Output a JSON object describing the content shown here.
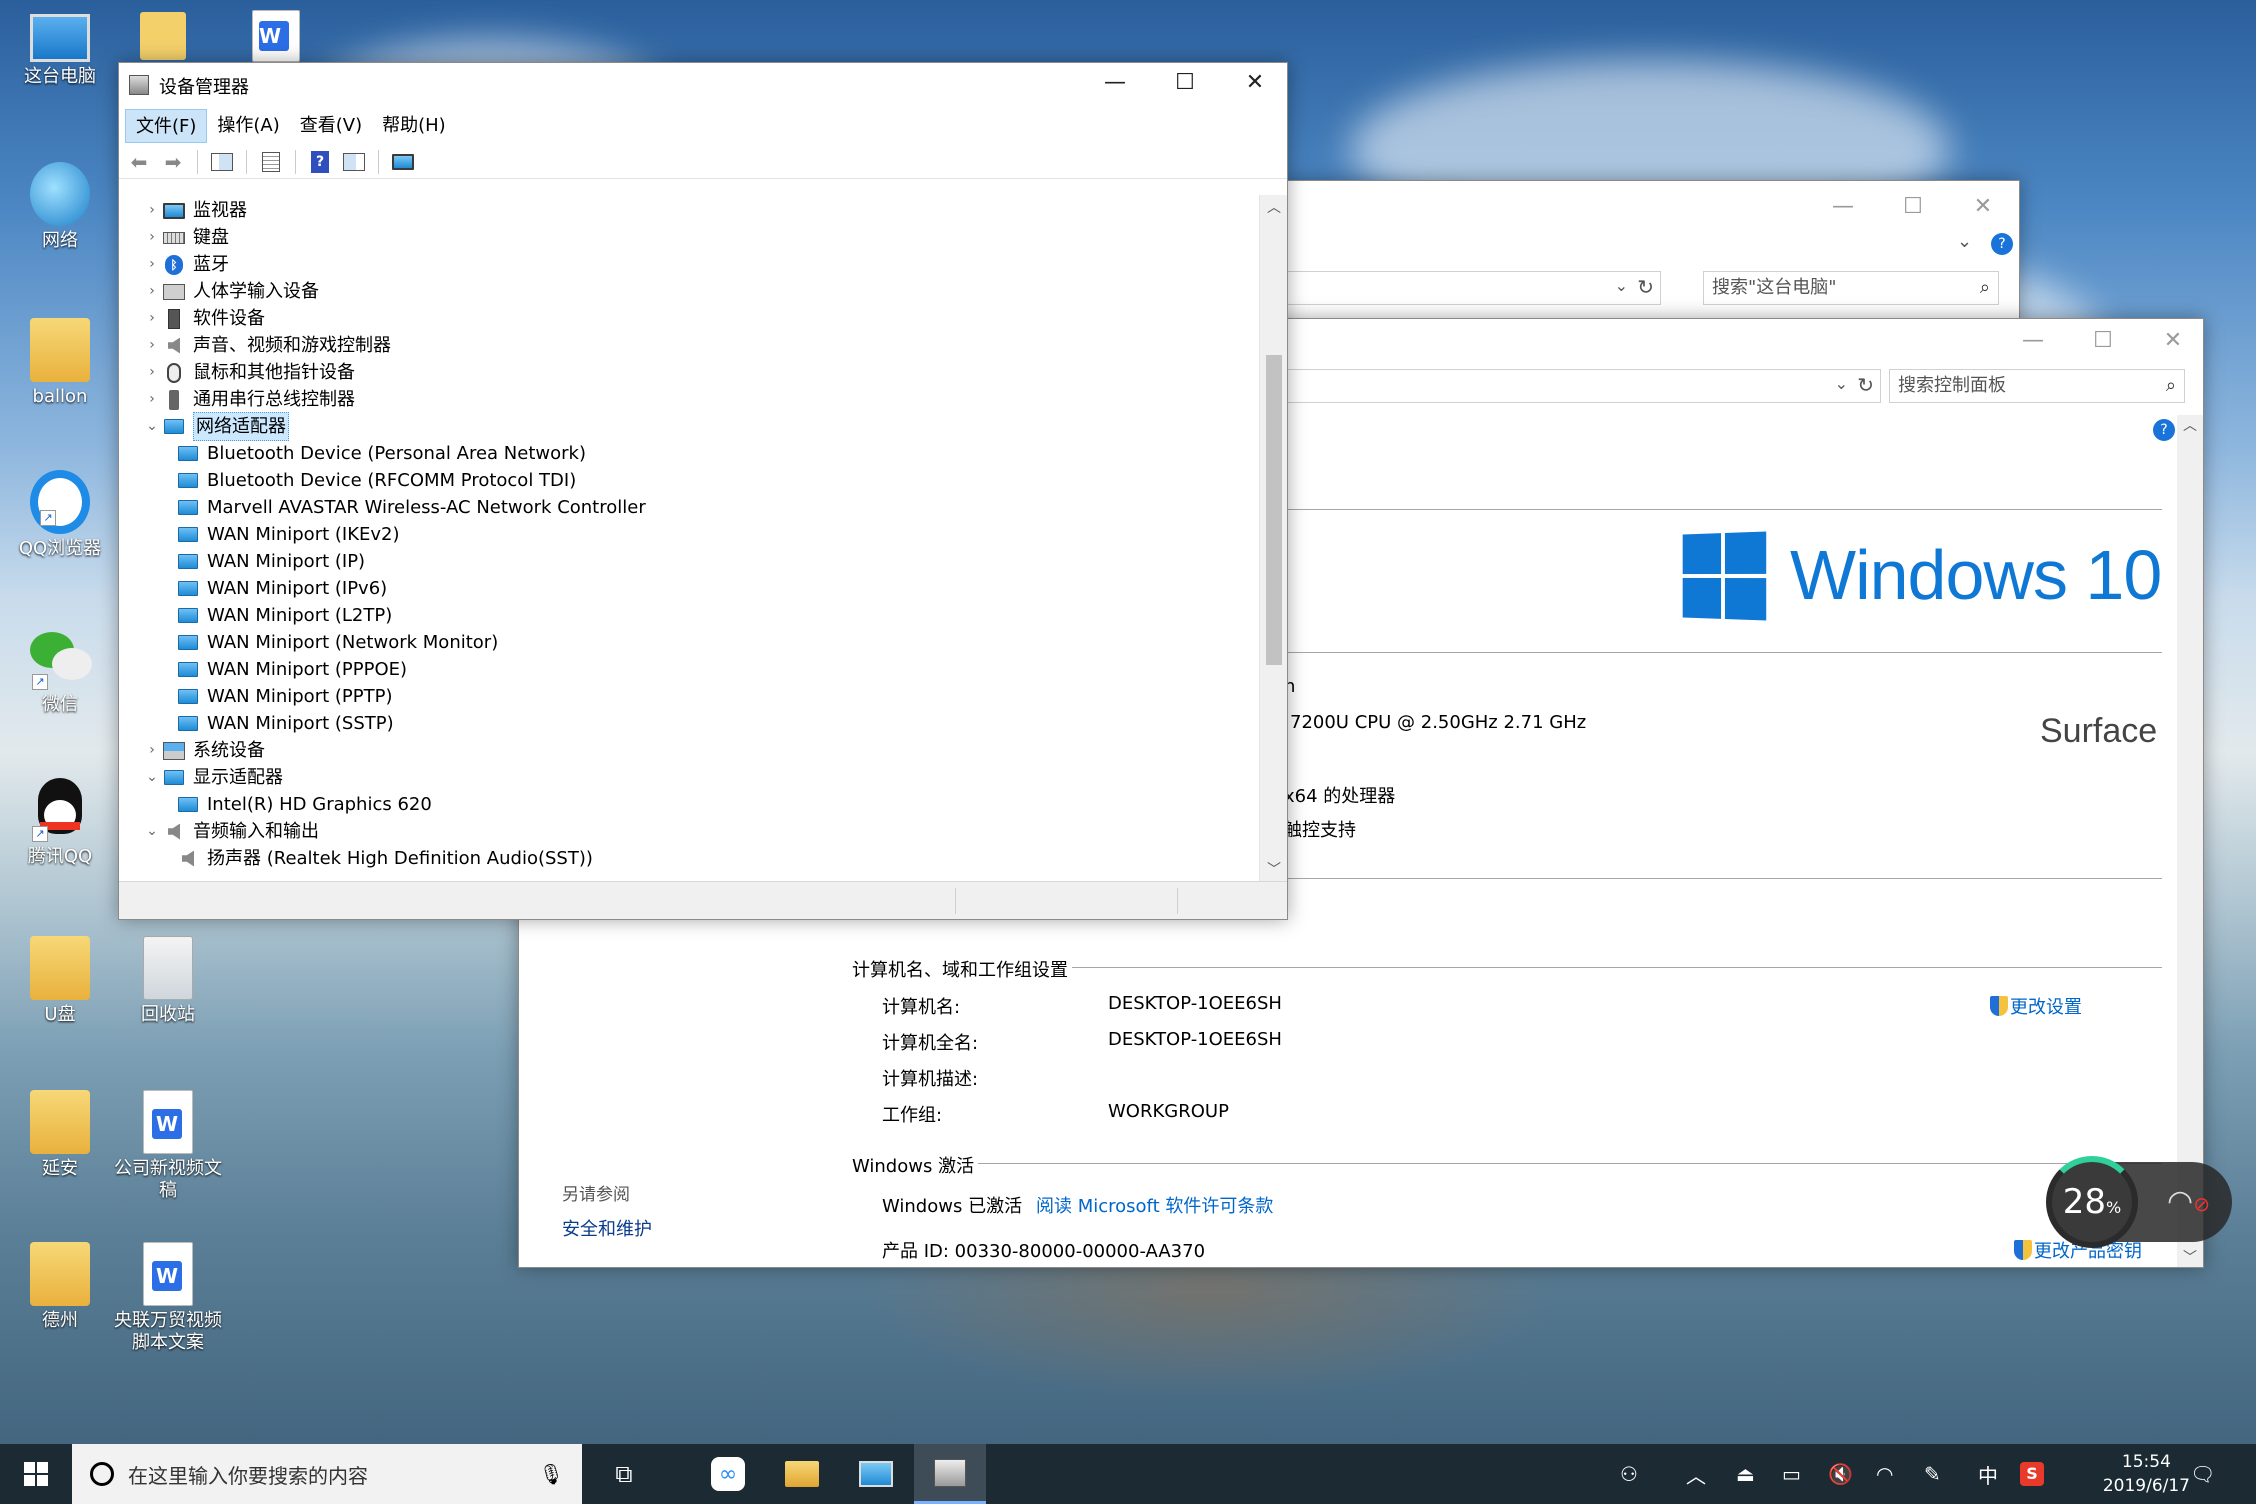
{
  "desktop": {
    "icons": [
      {
        "label": "这台电脑"
      },
      {
        "label": "网络"
      },
      {
        "label": "ballon"
      },
      {
        "label": "QQ浏览器"
      },
      {
        "label": "微信"
      },
      {
        "label": "腾讯QQ"
      },
      {
        "label": "U盘"
      },
      {
        "label": "回收站"
      },
      {
        "label": "延安"
      },
      {
        "label": "公司新视频文稿"
      },
      {
        "label": "德州"
      },
      {
        "label": "央联万贸视频脚本文案"
      }
    ]
  },
  "explorer": {
    "search_placeholder": "搜索\"这台电脑\""
  },
  "system": {
    "search_placeholder": "搜索控制面板",
    "brand": "Windows 10",
    "oem": "Surface",
    "partial": {
      "edition_tail": "n",
      "cpu": "7200U CPU @ 2.50GHz   2.71 GHz",
      "arch": "x64 的处理器",
      "touch": "触控支持"
    },
    "computer_section": {
      "heading": "计算机名、域和工作组设置",
      "rows": [
        {
          "k": "计算机名:",
          "v": "DESKTOP-1OEE6SH"
        },
        {
          "k": "计算机全名:",
          "v": "DESKTOP-1OEE6SH"
        },
        {
          "k": "计算机描述:",
          "v": ""
        },
        {
          "k": "工作组:",
          "v": "WORKGROUP"
        }
      ],
      "change_link": "更改设置"
    },
    "activation_section": {
      "heading": "Windows 激活",
      "status": "Windows 已激活",
      "license_link": "阅读 Microsoft 软件许可条款",
      "product_id": "产品 ID: 00330-80000-00000-AA370",
      "change_key_link": "更改产品密钥"
    },
    "see_also": {
      "heading": "另请参阅",
      "link": "安全和维护"
    }
  },
  "devmgr": {
    "title": "设备管理器",
    "menu": [
      "文件(F)",
      "操作(A)",
      "查看(V)",
      "帮助(H)"
    ],
    "tree": [
      {
        "label": "监视器",
        "level": 0,
        "exp": "›",
        "icon": "monitor-icon"
      },
      {
        "label": "键盘",
        "level": 0,
        "exp": "›",
        "icon": "keyboard-icon"
      },
      {
        "label": "蓝牙",
        "level": 0,
        "exp": "›",
        "icon": "bluetooth-icon"
      },
      {
        "label": "人体学输入设备",
        "level": 0,
        "exp": "›",
        "icon": "hid-icon"
      },
      {
        "label": "软件设备",
        "level": 0,
        "exp": "›",
        "icon": "software-device-icon"
      },
      {
        "label": "声音、视频和游戏控制器",
        "level": 0,
        "exp": "›",
        "icon": "speaker-icon"
      },
      {
        "label": "鼠标和其他指针设备",
        "level": 0,
        "exp": "›",
        "icon": "mouse-icon"
      },
      {
        "label": "通用串行总线控制器",
        "level": 0,
        "exp": "›",
        "icon": "usb-icon"
      },
      {
        "label": "网络适配器",
        "level": 0,
        "exp": "⌄",
        "icon": "network-adapter-icon",
        "selected": true
      },
      {
        "label": "Bluetooth Device (Personal Area Network)",
        "level": 1,
        "exp": "",
        "icon": "network-adapter-icon"
      },
      {
        "label": "Bluetooth Device (RFCOMM Protocol TDI)",
        "level": 1,
        "exp": "",
        "icon": "network-adapter-icon"
      },
      {
        "label": "Marvell AVASTAR Wireless-AC Network Controller",
        "level": 1,
        "exp": "",
        "icon": "network-adapter-icon"
      },
      {
        "label": "WAN Miniport (IKEv2)",
        "level": 1,
        "exp": "",
        "icon": "network-adapter-icon"
      },
      {
        "label": "WAN Miniport (IP)",
        "level": 1,
        "exp": "",
        "icon": "network-adapter-icon"
      },
      {
        "label": "WAN Miniport (IPv6)",
        "level": 1,
        "exp": "",
        "icon": "network-adapter-icon"
      },
      {
        "label": "WAN Miniport (L2TP)",
        "level": 1,
        "exp": "",
        "icon": "network-adapter-icon"
      },
      {
        "label": "WAN Miniport (Network Monitor)",
        "level": 1,
        "exp": "",
        "icon": "network-adapter-icon"
      },
      {
        "label": "WAN Miniport (PPPOE)",
        "level": 1,
        "exp": "",
        "icon": "network-adapter-icon"
      },
      {
        "label": "WAN Miniport (PPTP)",
        "level": 1,
        "exp": "",
        "icon": "network-adapter-icon"
      },
      {
        "label": "WAN Miniport (SSTP)",
        "level": 1,
        "exp": "",
        "icon": "network-adapter-icon"
      },
      {
        "label": "系统设备",
        "level": 0,
        "exp": "›",
        "icon": "system-device-icon"
      },
      {
        "label": "显示适配器",
        "level": 0,
        "exp": "⌄",
        "icon": "display-adapter-icon"
      },
      {
        "label": "Intel(R) HD Graphics 620",
        "level": 1,
        "exp": "",
        "icon": "display-adapter-icon"
      },
      {
        "label": "音频输入和输出",
        "level": 0,
        "exp": "⌄",
        "icon": "audio-icon"
      },
      {
        "label": "扬声器 (Realtek High Definition Audio(SST))",
        "level": 1,
        "exp": "",
        "icon": "speaker-icon"
      }
    ]
  },
  "gauge": {
    "value": "28",
    "unit": "%"
  },
  "taskbar": {
    "search_placeholder": "在这里输入你要搜索的内容",
    "ime": "中",
    "time": "15:54",
    "date": "2019/6/17"
  }
}
